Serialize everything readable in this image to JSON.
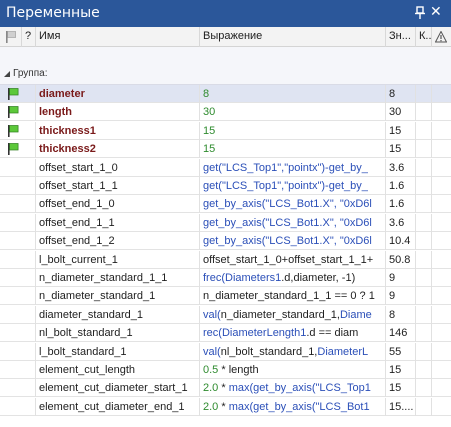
{
  "window": {
    "title": "Переменные",
    "close_glyph": "✕"
  },
  "columns": {
    "question": "?",
    "name": "Имя",
    "expression": "Выражение",
    "value": "Зн...",
    "k": "К..."
  },
  "group": {
    "label": "Группа:"
  },
  "rows": [
    {
      "flag": true,
      "name": "diameter",
      "expr": [
        {
          "t": "8",
          "c": "sg"
        }
      ],
      "value": "8"
    },
    {
      "flag": true,
      "name": "length",
      "expr": [
        {
          "t": "30",
          "c": "sg"
        }
      ],
      "value": "30"
    },
    {
      "flag": true,
      "name": "thickness1",
      "expr": [
        {
          "t": "15",
          "c": "sg"
        }
      ],
      "value": "15"
    },
    {
      "flag": true,
      "name": "thickness2",
      "expr": [
        {
          "t": "15",
          "c": "sg"
        }
      ],
      "value": "15"
    },
    {
      "flag": false,
      "name": "offset_start_1_0",
      "expr": [
        {
          "t": "get(",
          "c": "fn"
        },
        {
          "t": "\"LCS_Top1\"",
          "c": "fn"
        },
        {
          "t": ",",
          "c": "fn"
        },
        {
          "t": "\"pointx\"",
          "c": "fn"
        },
        {
          "t": ")-get_by_",
          "c": "fn"
        }
      ],
      "value": "3.6"
    },
    {
      "flag": false,
      "name": "offset_start_1_1",
      "expr": [
        {
          "t": "get(",
          "c": "fn"
        },
        {
          "t": "\"LCS_Top1\"",
          "c": "fn"
        },
        {
          "t": ",",
          "c": "fn"
        },
        {
          "t": "\"pointx\"",
          "c": "fn"
        },
        {
          "t": ")-get_by_",
          "c": "fn"
        }
      ],
      "value": "1.6"
    },
    {
      "flag": false,
      "name": "offset_end_1_0",
      "expr": [
        {
          "t": "get_by_axis(",
          "c": "fn"
        },
        {
          "t": "\"LCS_Bot1.X\", \"0xD6l",
          "c": "fn"
        }
      ],
      "value": "1.6"
    },
    {
      "flag": false,
      "name": "offset_end_1_1",
      "expr": [
        {
          "t": "get_by_axis(",
          "c": "fn"
        },
        {
          "t": "\"LCS_Bot1.X\", \"0xD6l",
          "c": "fn"
        }
      ],
      "value": "3.6"
    },
    {
      "flag": false,
      "name": "offset_end_1_2",
      "expr": [
        {
          "t": "get_by_axis(",
          "c": "fn"
        },
        {
          "t": "\"LCS_Bot1.X\", \"0xD6l",
          "c": "fn"
        }
      ],
      "value": "10.4"
    },
    {
      "flag": false,
      "name": "l_bolt_current_1",
      "expr": [
        {
          "t": "offset_start_1_0+offset_start_1_1+",
          "c": "tx"
        }
      ],
      "value": "50.8"
    },
    {
      "flag": false,
      "name": "n_diameter_standard_1_1",
      "expr": [
        {
          "t": "frec(",
          "c": "fn"
        },
        {
          "t": "Diameters1",
          "c": "fn"
        },
        {
          "t": ".d,diameter, -1)",
          "c": "tx"
        }
      ],
      "value": "9"
    },
    {
      "flag": false,
      "name": "n_diameter_standard_1",
      "expr": [
        {
          "t": "n_diameter_standard_1_1 == 0 ? 1",
          "c": "tx"
        }
      ],
      "value": "9"
    },
    {
      "flag": false,
      "name": "diameter_standard_1",
      "expr": [
        {
          "t": "val(",
          "c": "fn"
        },
        {
          "t": "n_diameter_standard_1,",
          "c": "tx"
        },
        {
          "t": "Diame",
          "c": "fn"
        }
      ],
      "value": "8"
    },
    {
      "flag": false,
      "name": "nl_bolt_standard_1",
      "expr": [
        {
          "t": "rec(",
          "c": "fn"
        },
        {
          "t": "DiameterLength1",
          "c": "fn"
        },
        {
          "t": ".d == diam",
          "c": "tx"
        }
      ],
      "value": "146"
    },
    {
      "flag": false,
      "name": "l_bolt_standard_1",
      "expr": [
        {
          "t": "val(",
          "c": "fn"
        },
        {
          "t": "nl_bolt_standard_1,",
          "c": "tx"
        },
        {
          "t": "DiameterL",
          "c": "fn"
        }
      ],
      "value": "55"
    },
    {
      "flag": false,
      "name": "element_cut_length",
      "expr": [
        {
          "t": "0.5",
          "c": "sg"
        },
        {
          "t": " * length",
          "c": "tx"
        }
      ],
      "value": "15"
    },
    {
      "flag": false,
      "name": "element_cut_diameter_start_1",
      "expr": [
        {
          "t": "2.0",
          "c": "sg"
        },
        {
          "t": " * ",
          "c": "tx"
        },
        {
          "t": "max(",
          "c": "fn"
        },
        {
          "t": "get_by_axis(",
          "c": "fn"
        },
        {
          "t": "\"LCS_Top1",
          "c": "fn"
        }
      ],
      "value": "15"
    },
    {
      "flag": false,
      "name": "element_cut_diameter_end_1",
      "expr": [
        {
          "t": "2.0",
          "c": "sg"
        },
        {
          "t": " * ",
          "c": "tx"
        },
        {
          "t": "max(",
          "c": "fn"
        },
        {
          "t": "get_by_axis(",
          "c": "fn"
        },
        {
          "t": "\"LCS_Bot1",
          "c": "fn"
        }
      ],
      "value": "15...."
    }
  ]
}
